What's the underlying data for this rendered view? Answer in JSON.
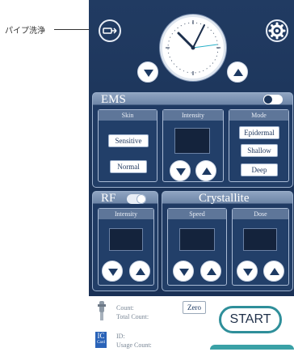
{
  "callout": {
    "label": "パイプ洗浄"
  },
  "ems": {
    "title": "EMS",
    "skin": {
      "header": "Skin",
      "options": [
        "Sensitive",
        "Normal"
      ]
    },
    "intensity": {
      "header": "Intensity"
    },
    "mode": {
      "header": "Mode",
      "options": [
        "Epidermal",
        "Shallow",
        "Deep"
      ]
    }
  },
  "rf": {
    "title": "RF",
    "intensity_header": "Intensity"
  },
  "crystallite": {
    "title": "Crystallite",
    "speed_header": "Speed",
    "dose_header": "Dose"
  },
  "footer": {
    "count_label": "Count:",
    "total_count_label": "Total Count:",
    "zero_label": "Zero",
    "start_label": "START",
    "ic_label": "IC",
    "card_label": "Card",
    "id_label": "ID:",
    "usage_count_label": "Usage Count:"
  },
  "colors": {
    "panel": "#213b62",
    "accent": "#3aa1a6",
    "clock_second_hand": "#27b0c8"
  },
  "icons": {
    "pipe_clean": "pipe-clean-icon",
    "settings": "gear-icon",
    "down": "triangle-down-icon",
    "up": "triangle-up-icon",
    "handpiece": "handpiece-icon"
  }
}
